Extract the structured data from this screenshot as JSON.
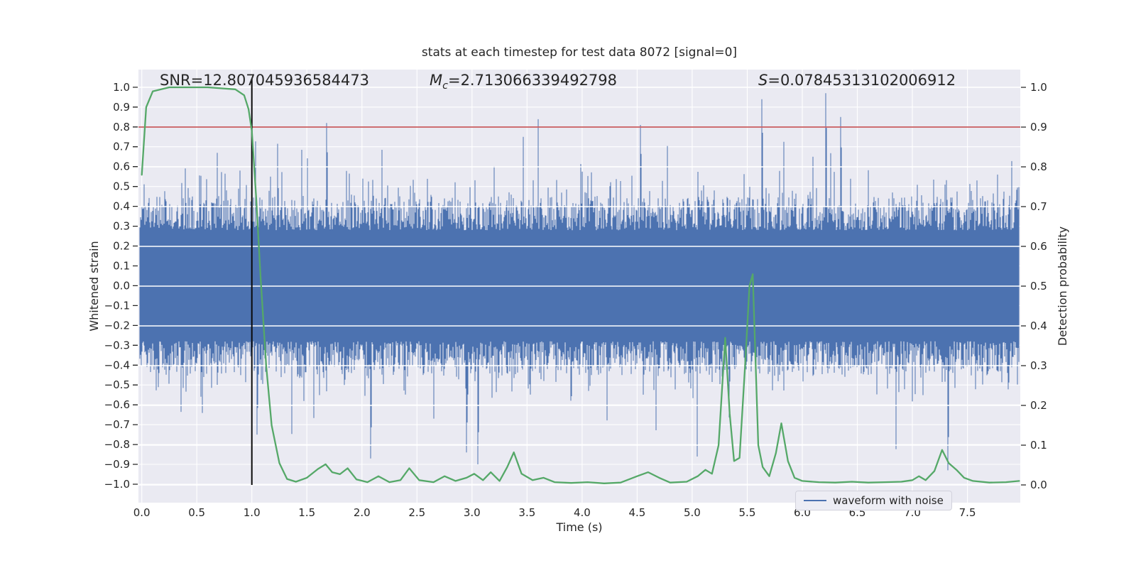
{
  "chart_data": {
    "type": "line",
    "title": "stats at each timestep for test data 8072 [signal=0]",
    "xlabel": "Time (s)",
    "ylabel_left": "Whitened strain",
    "ylabel_right": "Detection probability",
    "annotations": {
      "snr": "SNR=12.807045936584473",
      "mc_m": "M",
      "mc_sub": "c",
      "mc_rest": "=2.713066339492798",
      "s_s": "S",
      "s_rest": "=0.07845313102006912"
    },
    "legend": [
      "waveform with noise"
    ],
    "xlim": [
      -0.03,
      7.98
    ],
    "ylim_left": [
      -1.093,
      1.089
    ],
    "ylim_right": [
      -0.0446,
      1.0446
    ],
    "xticks": {
      "values": [
        0,
        0.5,
        1,
        1.5,
        2,
        2.5,
        3,
        3.5,
        4,
        4.5,
        5,
        5.5,
        6,
        6.5,
        7,
        7.5
      ],
      "labels": [
        "0.0",
        "0.5",
        "1.0",
        "1.5",
        "2.0",
        "2.5",
        "3.0",
        "3.5",
        "4.0",
        "4.5",
        "5.0",
        "5.5",
        "6.0",
        "6.5",
        "7.0",
        "7.5"
      ]
    },
    "yticks_left": {
      "values": [
        1.0,
        0.9,
        0.8,
        0.7,
        0.6,
        0.5,
        0.4,
        0.3,
        0.2,
        0.1,
        0.0,
        -0.1,
        -0.2,
        -0.3,
        -0.4,
        -0.5,
        -0.6,
        -0.7,
        -0.8,
        -0.9,
        -1.0
      ],
      "labels": [
        "1.0",
        "0.9",
        "0.8",
        "0.7",
        "0.6",
        "0.5",
        "0.4",
        "0.3",
        "0.2",
        "0.1",
        "0.0",
        "−0.1",
        "−0.2",
        "−0.3",
        "−0.4",
        "−0.5",
        "−0.6",
        "−0.7",
        "−0.8",
        "−0.9",
        "−1.0"
      ]
    },
    "yticks_right": {
      "values": [
        1.0,
        0.9,
        0.8,
        0.7,
        0.6,
        0.5,
        0.4,
        0.3,
        0.2,
        0.1,
        0.0
      ],
      "labels": [
        "1.0",
        "0.9",
        "0.8",
        "0.7",
        "0.6",
        "0.5",
        "0.4",
        "0.3",
        "0.2",
        "0.1",
        "0.0"
      ]
    },
    "threshold_right": 0.9,
    "vline_t": 1.0,
    "colors": {
      "waveform": "#4c72b0",
      "probability": "#55a868",
      "threshold": "#c44e52",
      "vline": "#0a0a0a",
      "plot_bg": "#eaeaf2",
      "grid": "#ffffff",
      "text": "#262626"
    },
    "detection_probability": [
      [
        0.0,
        0.78
      ],
      [
        0.04,
        0.95
      ],
      [
        0.1,
        0.99
      ],
      [
        0.25,
        1.0
      ],
      [
        0.6,
        1.0
      ],
      [
        0.85,
        0.995
      ],
      [
        0.93,
        0.98
      ],
      [
        0.97,
        0.945
      ],
      [
        1.0,
        0.89
      ],
      [
        1.04,
        0.72
      ],
      [
        1.08,
        0.52
      ],
      [
        1.13,
        0.3
      ],
      [
        1.18,
        0.15
      ],
      [
        1.25,
        0.055
      ],
      [
        1.32,
        0.015
      ],
      [
        1.4,
        0.008
      ],
      [
        1.5,
        0.018
      ],
      [
        1.6,
        0.04
      ],
      [
        1.67,
        0.052
      ],
      [
        1.73,
        0.032
      ],
      [
        1.8,
        0.027
      ],
      [
        1.87,
        0.042
      ],
      [
        1.95,
        0.014
      ],
      [
        2.05,
        0.007
      ],
      [
        2.15,
        0.022
      ],
      [
        2.25,
        0.007
      ],
      [
        2.35,
        0.012
      ],
      [
        2.43,
        0.042
      ],
      [
        2.52,
        0.012
      ],
      [
        2.65,
        0.007
      ],
      [
        2.75,
        0.022
      ],
      [
        2.85,
        0.01
      ],
      [
        2.95,
        0.018
      ],
      [
        3.02,
        0.028
      ],
      [
        3.1,
        0.012
      ],
      [
        3.17,
        0.032
      ],
      [
        3.25,
        0.01
      ],
      [
        3.32,
        0.045
      ],
      [
        3.38,
        0.082
      ],
      [
        3.45,
        0.028
      ],
      [
        3.55,
        0.012
      ],
      [
        3.65,
        0.018
      ],
      [
        3.75,
        0.007
      ],
      [
        3.9,
        0.005
      ],
      [
        4.05,
        0.007
      ],
      [
        4.2,
        0.004
      ],
      [
        4.35,
        0.006
      ],
      [
        4.5,
        0.022
      ],
      [
        4.6,
        0.032
      ],
      [
        4.7,
        0.018
      ],
      [
        4.8,
        0.006
      ],
      [
        4.95,
        0.008
      ],
      [
        5.05,
        0.022
      ],
      [
        5.12,
        0.038
      ],
      [
        5.18,
        0.028
      ],
      [
        5.24,
        0.1
      ],
      [
        5.3,
        0.37
      ],
      [
        5.34,
        0.18
      ],
      [
        5.38,
        0.06
      ],
      [
        5.43,
        0.068
      ],
      [
        5.48,
        0.3
      ],
      [
        5.52,
        0.5
      ],
      [
        5.55,
        0.53
      ],
      [
        5.6,
        0.1
      ],
      [
        5.64,
        0.045
      ],
      [
        5.7,
        0.022
      ],
      [
        5.76,
        0.08
      ],
      [
        5.81,
        0.155
      ],
      [
        5.87,
        0.06
      ],
      [
        5.93,
        0.018
      ],
      [
        6.0,
        0.01
      ],
      [
        6.15,
        0.007
      ],
      [
        6.3,
        0.006
      ],
      [
        6.45,
        0.008
      ],
      [
        6.6,
        0.006
      ],
      [
        6.75,
        0.007
      ],
      [
        6.9,
        0.008
      ],
      [
        7.0,
        0.012
      ],
      [
        7.06,
        0.022
      ],
      [
        7.12,
        0.012
      ],
      [
        7.2,
        0.035
      ],
      [
        7.27,
        0.088
      ],
      [
        7.33,
        0.055
      ],
      [
        7.4,
        0.038
      ],
      [
        7.47,
        0.018
      ],
      [
        7.55,
        0.01
      ],
      [
        7.7,
        0.006
      ],
      [
        7.85,
        0.007
      ],
      [
        7.97,
        0.01
      ]
    ],
    "noise": {
      "seed": 1337,
      "core_min": 0.28,
      "core_var": 0.17,
      "mid_prob": 0.18,
      "mid_extra": 0.16,
      "spike_prob": 0.015,
      "spike_base": 0.15,
      "spike_extra": 0.28,
      "feature_spikes": [
        {
          "t": 1.68,
          "v": 0.82
        },
        {
          "t": 4.53,
          "v": 0.81
        },
        {
          "t": 5.63,
          "v": 0.94
        },
        {
          "t": 6.21,
          "v": 0.97
        },
        {
          "t": 6.35,
          "v": 0.85
        },
        {
          "t": 1.05,
          "v": -0.75
        },
        {
          "t": 2.08,
          "v": -0.87
        },
        {
          "t": 2.95,
          "v": -0.84
        },
        {
          "t": 3.05,
          "v": -0.9
        },
        {
          "t": 7.32,
          "v": -0.93
        }
      ]
    }
  }
}
